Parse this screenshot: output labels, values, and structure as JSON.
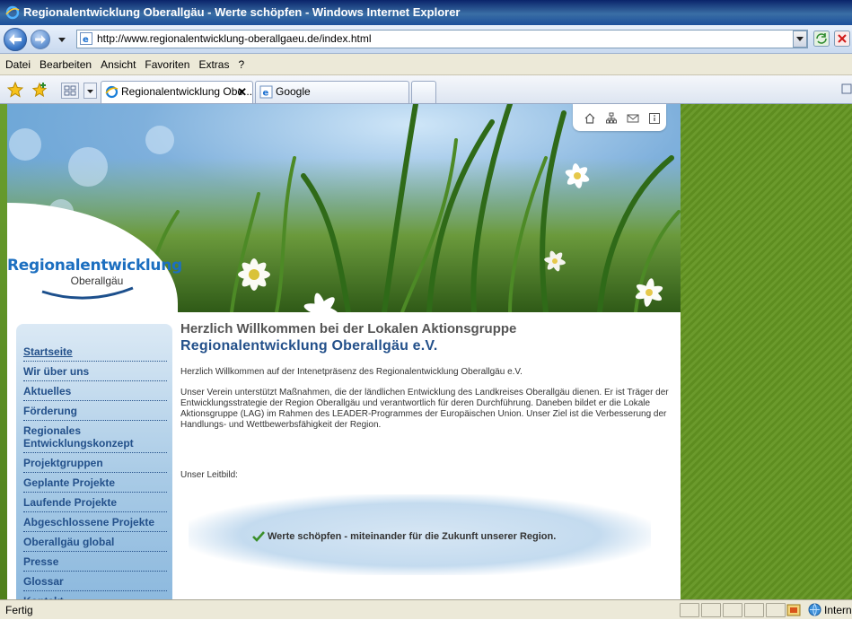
{
  "window": {
    "title": "Regionalentwicklung Oberallgäu - Werte schöpfen - Windows Internet Explorer"
  },
  "address_bar": {
    "url": "http://www.regionalentwicklung-oberallgaeu.de/index.html"
  },
  "menu": [
    "Datei",
    "Bearbeiten",
    "Ansicht",
    "Favoriten",
    "Extras",
    "?"
  ],
  "tabs": [
    {
      "label": "Regionalentwicklung Obe...",
      "active": true
    },
    {
      "label": "Google",
      "active": false
    }
  ],
  "site": {
    "logo_title": "Regionalentwicklung",
    "logo_subtitle": "Oberallgäu",
    "nav": [
      "Startseite",
      "Wir über uns",
      "Aktuelles",
      "Förderung",
      "Regionales Entwicklungskonzept",
      "Projektgruppen",
      "Geplante Projekte",
      "Laufende Projekte",
      "Abgeschlossene Projekte",
      "Oberallgäu global",
      "Presse",
      "Glossar",
      "Kontakt"
    ],
    "heading_welcome": "Herzlich Willkommen bei der Lokalen Aktionsgruppe",
    "heading_org": "Regionalentwicklung Oberallgäu e.V.",
    "intro": "Herzlich Willkommen auf der Intenetpräsenz des Regionalentwicklung Oberallgäu e.V.",
    "body": "Unser Verein unterstützt Maßnahmen, die der ländlichen Entwicklung des Landkreises Oberallgäu dienen. Er ist Träger der Entwicklungsstrategie der Region Oberallgäu und verantwortlich für deren Durchführung. Daneben bildet er die Lokale Aktionsgruppe (LAG) im Rahmen des LEADER-Programmes der Europäischen Union. Unser Ziel ist die Verbesserung der Handlungs- und Wettbewerbsfähigkeit der Region.",
    "leitbild_label": "Unser Leitbild:",
    "motto": "Werte schöpfen - miteinander für die Zukunft unserer Region."
  },
  "status": {
    "text": "Fertig",
    "zone": "Interne"
  },
  "colors": {
    "nav_text": "#23508a",
    "logo_blue": "#1c6fc0",
    "green_panel": "#6b9a2c"
  },
  "icons": [
    "ie-logo",
    "back-icon",
    "forward-icon",
    "refresh-icon",
    "stop-icon",
    "favorites-star-icon",
    "add-favorite-icon",
    "home-icon",
    "sitemap-icon",
    "mail-icon",
    "info-icon",
    "check-icon",
    "globe-icon"
  ]
}
